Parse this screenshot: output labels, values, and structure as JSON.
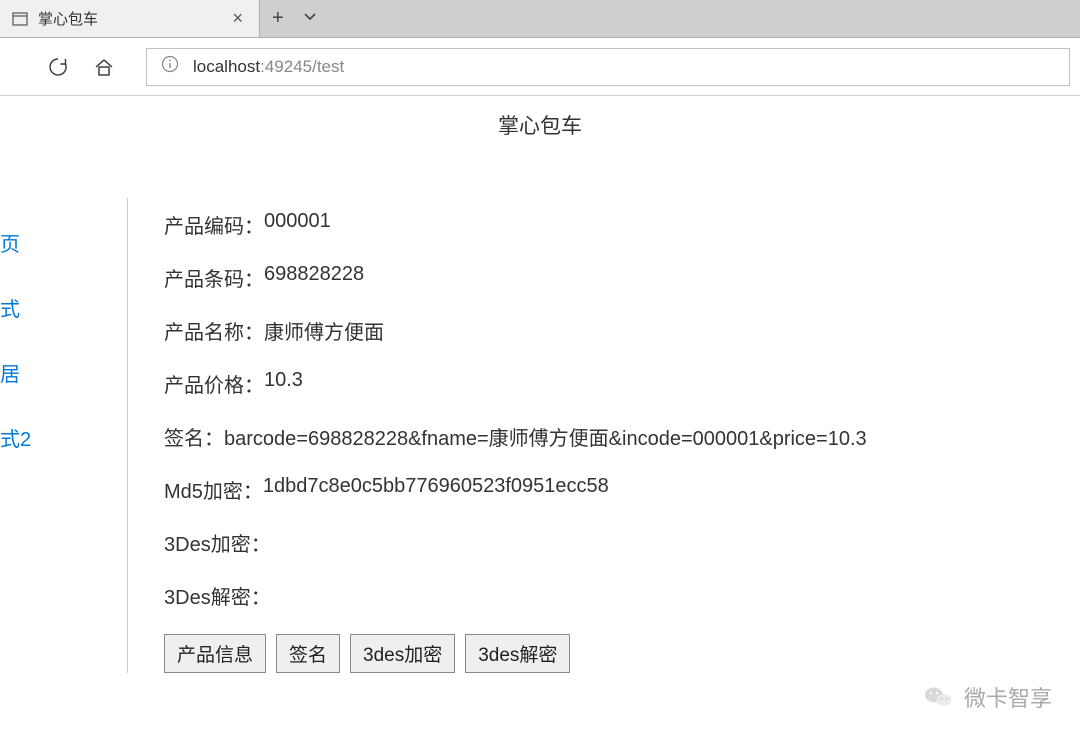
{
  "browser": {
    "tab_title": "掌心包车",
    "url_host": "localhost",
    "url_port_path": ":49245/test"
  },
  "page": {
    "title": "掌心包车"
  },
  "sidebar": {
    "items": [
      {
        "label": "页"
      },
      {
        "label": "式"
      },
      {
        "label": "居"
      },
      {
        "label": "式2"
      }
    ]
  },
  "info": {
    "rows": [
      {
        "label": "产品编码：",
        "value": "000001"
      },
      {
        "label": "产品条码：",
        "value": "698828228"
      },
      {
        "label": "产品名称：",
        "value": "康师傅方便面"
      },
      {
        "label": "产品价格：",
        "value": "10.3"
      },
      {
        "label": "签名：",
        "value": "barcode=698828228&fname=康师傅方便面&incode=000001&price=10.3"
      },
      {
        "label": "Md5加密：",
        "value": "1dbd7c8e0c5bb776960523f0951ecc58"
      },
      {
        "label": "3Des加密：",
        "value": ""
      },
      {
        "label": "3Des解密：",
        "value": ""
      }
    ]
  },
  "buttons": {
    "product_info": "产品信息",
    "sign": "签名",
    "encrypt": "3des加密",
    "decrypt": "3des解密"
  },
  "watermark": {
    "text": "微卡智享"
  }
}
